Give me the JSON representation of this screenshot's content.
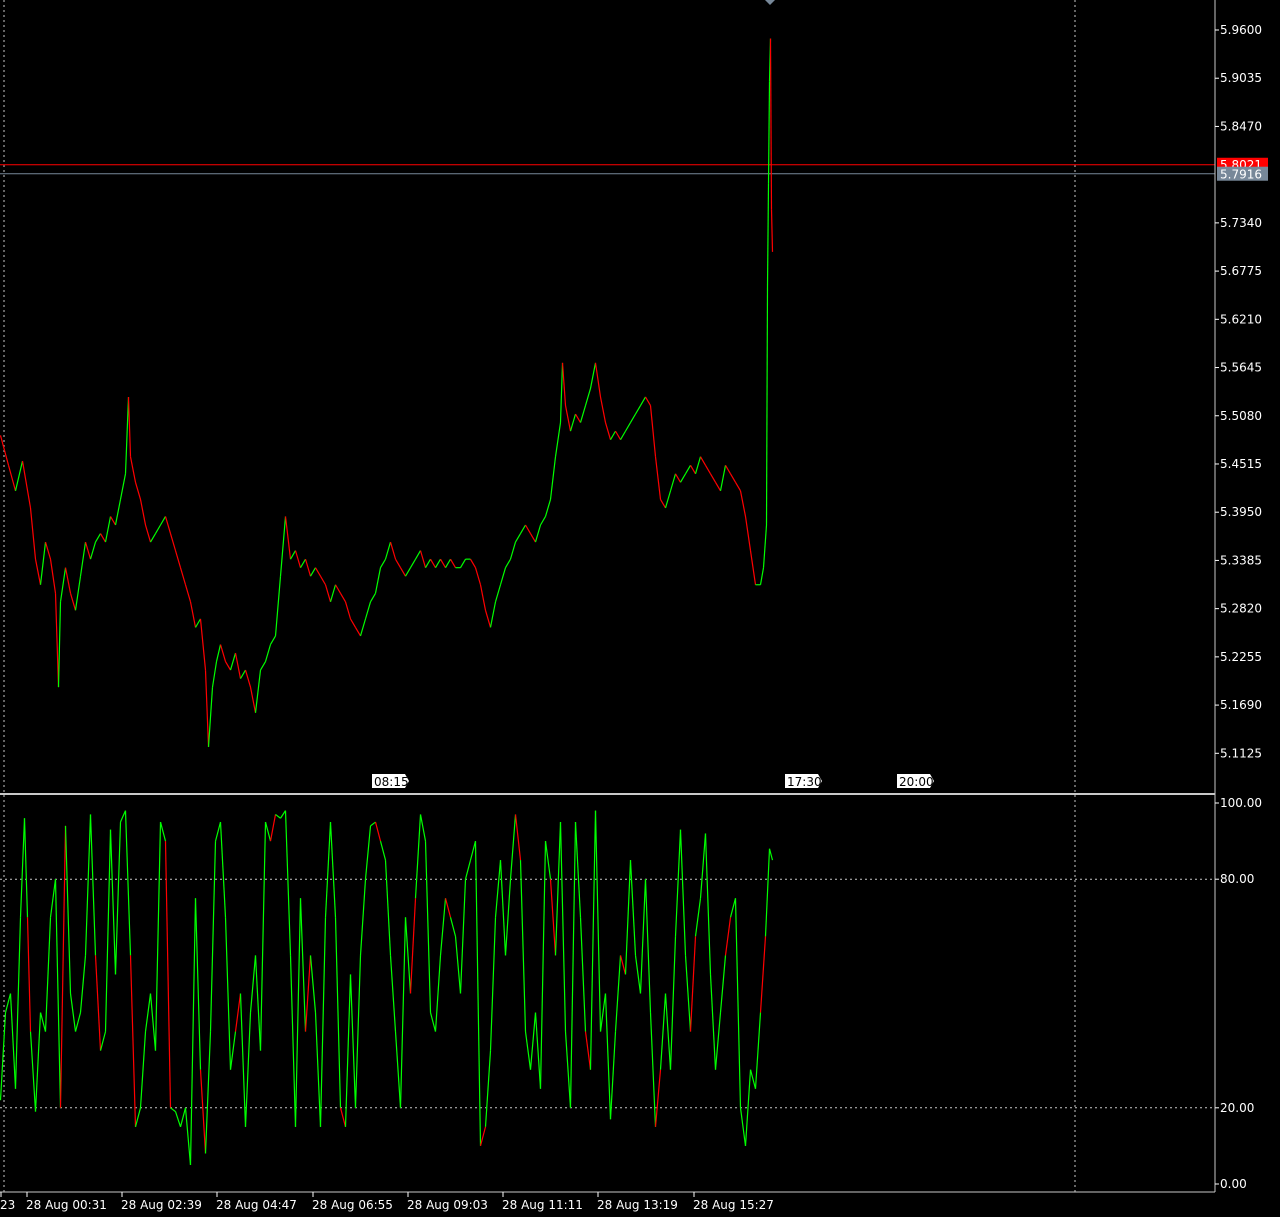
{
  "colors": {
    "background": "#000000",
    "bull": "#00FF00",
    "bear": "#FF0000",
    "axis_text": "#FFFFFF",
    "grid": "#C8C8C8",
    "bid_line": "#FF0000",
    "ask_line": "#778899",
    "bid_badge": "#FF0000",
    "ask_badge": "#778899",
    "separator": "#C8C8C8",
    "osc_line": "#00FF00",
    "osc_line_down": "#FF0000"
  },
  "chart_data": [
    {
      "type": "line",
      "title": "",
      "price_axis_ticks": [
        "5.9600",
        "5.9035",
        "5.8470",
        "5.7340",
        "5.6775",
        "5.6210",
        "5.5645",
        "5.5080",
        "5.4515",
        "5.3950",
        "5.3385",
        "5.2820",
        "5.2255",
        "5.1690",
        "5.1125"
      ],
      "ylim": [
        5.082,
        5.996
      ],
      "bid_price": "5.8021",
      "ask_price": "5.7916",
      "marker_labels": [
        "08:15",
        "17:30",
        "20:00"
      ],
      "time_labels": [
        "23",
        "28 Aug 00:31",
        "28 Aug 02:39",
        "28 Aug 04:47",
        "28 Aug 06:55",
        "28 Aug 09:03",
        "28 Aug 11:11",
        "28 Aug 13:19",
        "28 Aug 15:27"
      ],
      "price_path": [
        [
          0,
          5.485
        ],
        [
          8,
          5.45
        ],
        [
          15,
          5.42
        ],
        [
          22,
          5.455
        ],
        [
          30,
          5.4
        ],
        [
          35,
          5.34
        ],
        [
          40,
          5.31
        ],
        [
          45,
          5.36
        ],
        [
          50,
          5.34
        ],
        [
          55,
          5.3
        ],
        [
          58,
          5.19
        ],
        [
          60,
          5.29
        ],
        [
          65,
          5.33
        ],
        [
          70,
          5.3
        ],
        [
          75,
          5.28
        ],
        [
          80,
          5.32
        ],
        [
          85,
          5.36
        ],
        [
          90,
          5.34
        ],
        [
          95,
          5.36
        ],
        [
          100,
          5.37
        ],
        [
          105,
          5.36
        ],
        [
          110,
          5.39
        ],
        [
          115,
          5.38
        ],
        [
          120,
          5.41
        ],
        [
          125,
          5.44
        ],
        [
          128,
          5.53
        ],
        [
          130,
          5.46
        ],
        [
          135,
          5.43
        ],
        [
          140,
          5.41
        ],
        [
          145,
          5.38
        ],
        [
          150,
          5.36
        ],
        [
          155,
          5.37
        ],
        [
          160,
          5.38
        ],
        [
          165,
          5.39
        ],
        [
          170,
          5.37
        ],
        [
          175,
          5.35
        ],
        [
          180,
          5.33
        ],
        [
          185,
          5.31
        ],
        [
          190,
          5.29
        ],
        [
          195,
          5.26
        ],
        [
          200,
          5.27
        ],
        [
          205,
          5.21
        ],
        [
          208,
          5.12
        ],
        [
          212,
          5.19
        ],
        [
          216,
          5.22
        ],
        [
          220,
          5.24
        ],
        [
          225,
          5.22
        ],
        [
          230,
          5.21
        ],
        [
          235,
          5.23
        ],
        [
          240,
          5.2
        ],
        [
          245,
          5.21
        ],
        [
          250,
          5.19
        ],
        [
          255,
          5.16
        ],
        [
          260,
          5.21
        ],
        [
          265,
          5.22
        ],
        [
          270,
          5.24
        ],
        [
          275,
          5.25
        ],
        [
          280,
          5.32
        ],
        [
          285,
          5.39
        ],
        [
          290,
          5.34
        ],
        [
          295,
          5.35
        ],
        [
          300,
          5.33
        ],
        [
          305,
          5.34
        ],
        [
          310,
          5.32
        ],
        [
          315,
          5.33
        ],
        [
          320,
          5.32
        ],
        [
          325,
          5.31
        ],
        [
          330,
          5.29
        ],
        [
          335,
          5.31
        ],
        [
          340,
          5.3
        ],
        [
          345,
          5.29
        ],
        [
          350,
          5.27
        ],
        [
          355,
          5.26
        ],
        [
          360,
          5.25
        ],
        [
          365,
          5.27
        ],
        [
          370,
          5.29
        ],
        [
          375,
          5.3
        ],
        [
          380,
          5.33
        ],
        [
          385,
          5.34
        ],
        [
          390,
          5.36
        ],
        [
          395,
          5.34
        ],
        [
          400,
          5.33
        ],
        [
          405,
          5.32
        ],
        [
          410,
          5.33
        ],
        [
          415,
          5.34
        ],
        [
          420,
          5.35
        ],
        [
          425,
          5.33
        ],
        [
          430,
          5.34
        ],
        [
          435,
          5.33
        ],
        [
          440,
          5.34
        ],
        [
          445,
          5.33
        ],
        [
          450,
          5.34
        ],
        [
          455,
          5.33
        ],
        [
          460,
          5.33
        ],
        [
          465,
          5.34
        ],
        [
          470,
          5.34
        ],
        [
          475,
          5.33
        ],
        [
          480,
          5.31
        ],
        [
          485,
          5.28
        ],
        [
          490,
          5.26
        ],
        [
          495,
          5.29
        ],
        [
          500,
          5.31
        ],
        [
          505,
          5.33
        ],
        [
          510,
          5.34
        ],
        [
          515,
          5.36
        ],
        [
          520,
          5.37
        ],
        [
          525,
          5.38
        ],
        [
          530,
          5.37
        ],
        [
          535,
          5.36
        ],
        [
          540,
          5.38
        ],
        [
          545,
          5.39
        ],
        [
          550,
          5.41
        ],
        [
          555,
          5.46
        ],
        [
          560,
          5.5
        ],
        [
          562,
          5.57
        ],
        [
          565,
          5.52
        ],
        [
          570,
          5.49
        ],
        [
          575,
          5.51
        ],
        [
          580,
          5.5
        ],
        [
          585,
          5.52
        ],
        [
          590,
          5.54
        ],
        [
          595,
          5.57
        ],
        [
          600,
          5.53
        ],
        [
          605,
          5.5
        ],
        [
          610,
          5.48
        ],
        [
          615,
          5.49
        ],
        [
          620,
          5.48
        ],
        [
          625,
          5.49
        ],
        [
          630,
          5.5
        ],
        [
          635,
          5.51
        ],
        [
          640,
          5.52
        ],
        [
          645,
          5.53
        ],
        [
          650,
          5.52
        ],
        [
          655,
          5.46
        ],
        [
          660,
          5.41
        ],
        [
          665,
          5.4
        ],
        [
          670,
          5.42
        ],
        [
          675,
          5.44
        ],
        [
          680,
          5.43
        ],
        [
          685,
          5.44
        ],
        [
          690,
          5.45
        ],
        [
          695,
          5.44
        ],
        [
          700,
          5.46
        ],
        [
          705,
          5.45
        ],
        [
          710,
          5.44
        ],
        [
          715,
          5.43
        ],
        [
          720,
          5.42
        ],
        [
          725,
          5.45
        ],
        [
          730,
          5.44
        ],
        [
          735,
          5.43
        ],
        [
          740,
          5.42
        ],
        [
          745,
          5.39
        ],
        [
          750,
          5.35
        ],
        [
          755,
          5.31
        ],
        [
          760,
          5.31
        ],
        [
          763,
          5.33
        ],
        [
          766,
          5.38
        ],
        [
          767,
          5.66
        ],
        [
          768,
          5.78
        ],
        [
          769,
          5.9
        ],
        [
          770,
          5.95
        ],
        [
          771,
          5.75
        ],
        [
          772,
          5.7
        ]
      ]
    },
    {
      "type": "line",
      "title": "",
      "osc_axis_ticks": [
        "100.00",
        "80.00",
        "20.00",
        "0.00"
      ],
      "ylim": [
        0,
        100
      ],
      "levels": [
        80,
        20
      ],
      "osc_path": [
        [
          0,
          22
        ],
        [
          5,
          45
        ],
        [
          10,
          50
        ],
        [
          15,
          25
        ],
        [
          20,
          70
        ],
        [
          24,
          96
        ],
        [
          27,
          70
        ],
        [
          30,
          40
        ],
        [
          35,
          19
        ],
        [
          40,
          45
        ],
        [
          45,
          40
        ],
        [
          50,
          70
        ],
        [
          55,
          80
        ],
        [
          60,
          20
        ],
        [
          65,
          94
        ],
        [
          70,
          50
        ],
        [
          75,
          40
        ],
        [
          80,
          45
        ],
        [
          85,
          60
        ],
        [
          90,
          97
        ],
        [
          95,
          60
        ],
        [
          100,
          35
        ],
        [
          105,
          40
        ],
        [
          110,
          93
        ],
        [
          115,
          55
        ],
        [
          120,
          95
        ],
        [
          125,
          98
        ],
        [
          130,
          60
        ],
        [
          135,
          15
        ],
        [
          140,
          20
        ],
        [
          145,
          40
        ],
        [
          150,
          50
        ],
        [
          155,
          35
        ],
        [
          160,
          95
        ],
        [
          165,
          90
        ],
        [
          170,
          20
        ],
        [
          175,
          19
        ],
        [
          180,
          15
        ],
        [
          185,
          20
        ],
        [
          190,
          5
        ],
        [
          195,
          75
        ],
        [
          200,
          30
        ],
        [
          205,
          8
        ],
        [
          210,
          40
        ],
        [
          215,
          90
        ],
        [
          220,
          95
        ],
        [
          225,
          70
        ],
        [
          230,
          30
        ],
        [
          235,
          40
        ],
        [
          240,
          50
        ],
        [
          245,
          15
        ],
        [
          250,
          45
        ],
        [
          255,
          60
        ],
        [
          260,
          35
        ],
        [
          265,
          95
        ],
        [
          270,
          90
        ],
        [
          275,
          97
        ],
        [
          280,
          96
        ],
        [
          285,
          98
        ],
        [
          290,
          60
        ],
        [
          295,
          15
        ],
        [
          300,
          75
        ],
        [
          305,
          40
        ],
        [
          310,
          60
        ],
        [
          315,
          45
        ],
        [
          320,
          15
        ],
        [
          325,
          70
        ],
        [
          330,
          95
        ],
        [
          335,
          70
        ],
        [
          340,
          20
        ],
        [
          345,
          15
        ],
        [
          350,
          55
        ],
        [
          355,
          20
        ],
        [
          360,
          60
        ],
        [
          365,
          80
        ],
        [
          370,
          94
        ],
        [
          375,
          95
        ],
        [
          380,
          90
        ],
        [
          385,
          85
        ],
        [
          390,
          60
        ],
        [
          395,
          40
        ],
        [
          400,
          20
        ],
        [
          405,
          70
        ],
        [
          410,
          50
        ],
        [
          415,
          75
        ],
        [
          420,
          97
        ],
        [
          425,
          90
        ],
        [
          430,
          45
        ],
        [
          435,
          40
        ],
        [
          440,
          60
        ],
        [
          445,
          75
        ],
        [
          450,
          70
        ],
        [
          455,
          65
        ],
        [
          460,
          50
        ],
        [
          465,
          80
        ],
        [
          470,
          85
        ],
        [
          475,
          90
        ],
        [
          480,
          10
        ],
        [
          485,
          15
        ],
        [
          490,
          35
        ],
        [
          495,
          70
        ],
        [
          500,
          85
        ],
        [
          505,
          60
        ],
        [
          510,
          80
        ],
        [
          515,
          97
        ],
        [
          520,
          85
        ],
        [
          525,
          40
        ],
        [
          530,
          30
        ],
        [
          535,
          45
        ],
        [
          540,
          25
        ],
        [
          545,
          90
        ],
        [
          550,
          80
        ],
        [
          555,
          60
        ],
        [
          560,
          95
        ],
        [
          565,
          40
        ],
        [
          570,
          20
        ],
        [
          575,
          95
        ],
        [
          580,
          70
        ],
        [
          585,
          40
        ],
        [
          590,
          30
        ],
        [
          595,
          98
        ],
        [
          600,
          40
        ],
        [
          605,
          50
        ],
        [
          610,
          17
        ],
        [
          615,
          40
        ],
        [
          620,
          60
        ],
        [
          625,
          55
        ],
        [
          630,
          85
        ],
        [
          635,
          60
        ],
        [
          640,
          50
        ],
        [
          645,
          80
        ],
        [
          650,
          45
        ],
        [
          655,
          15
        ],
        [
          660,
          30
        ],
        [
          665,
          50
        ],
        [
          670,
          30
        ],
        [
          675,
          65
        ],
        [
          680,
          93
        ],
        [
          685,
          60
        ],
        [
          690,
          40
        ],
        [
          695,
          65
        ],
        [
          700,
          75
        ],
        [
          705,
          92
        ],
        [
          710,
          55
        ],
        [
          715,
          30
        ],
        [
          720,
          45
        ],
        [
          725,
          60
        ],
        [
          730,
          70
        ],
        [
          735,
          75
        ],
        [
          740,
          20
        ],
        [
          745,
          10
        ],
        [
          750,
          30
        ],
        [
          755,
          25
        ],
        [
          760,
          45
        ],
        [
          765,
          65
        ],
        [
          769,
          88
        ],
        [
          772,
          85
        ]
      ]
    }
  ]
}
